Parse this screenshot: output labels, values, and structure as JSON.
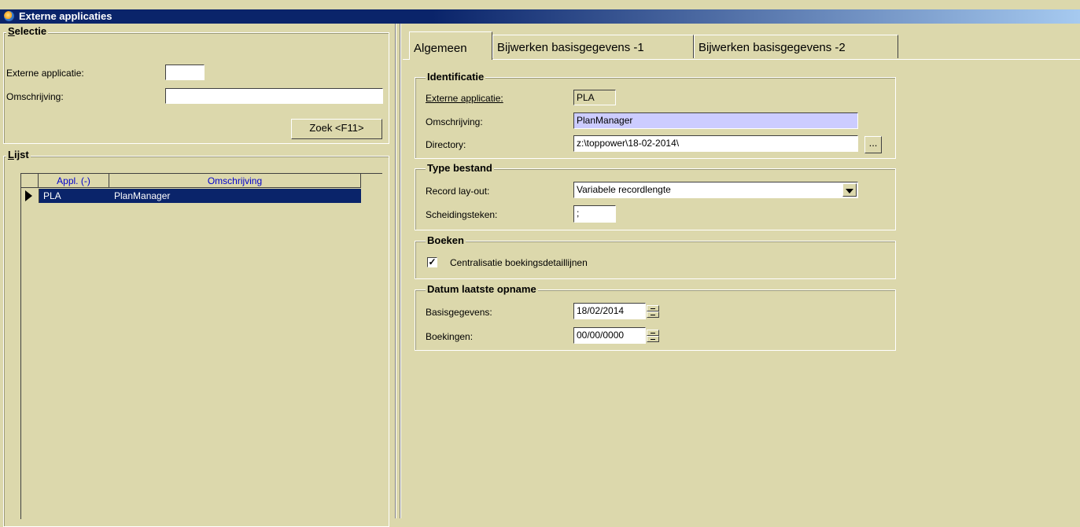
{
  "window": {
    "title": "Externe applicaties"
  },
  "selectie": {
    "title": "Selectie",
    "externe_applicatie_label": "Externe applicatie:",
    "externe_applicatie_value": "",
    "omschrijving_label": "Omschrijving:",
    "omschrijving_value": "",
    "zoek_button": "Zoek <F11>"
  },
  "lijst": {
    "title": "Lijst",
    "columns": [
      "Appl. (-)",
      "Omschrijving"
    ],
    "rows": [
      {
        "appl": "PLA",
        "omschrijving": "PlanManager"
      }
    ]
  },
  "tabs": [
    "Algemeen",
    "Bijwerken basisgegevens -1",
    "Bijwerken basisgegevens -2"
  ],
  "identificatie": {
    "title": "Identificatie",
    "externe_applicatie_label": "Externe applicatie:",
    "externe_applicatie_value": "PLA",
    "omschrijving_label": "Omschrijving:",
    "omschrijving_value": "PlanManager",
    "directory_label": "Directory:",
    "directory_value": "z:\\toppower\\18-02-2014\\",
    "browse_button": "..."
  },
  "type_bestand": {
    "title": "Type bestand",
    "record_layout_label": "Record lay-out:",
    "record_layout_value": "Variabele recordlengte",
    "scheidingsteken_label": "Scheidingsteken:",
    "scheidingsteken_value": ";"
  },
  "boeken": {
    "title": "Boeken",
    "centralisatie_label": "Centralisatie boekingsdetaillijnen",
    "centralisatie_checked": true
  },
  "datum": {
    "title": "Datum laatste opname",
    "basisgegevens_label": "Basisgegevens:",
    "basisgegevens_value": "18/02/2014",
    "boekingen_label": "Boekingen:",
    "boekingen_value": "00/00/0000"
  }
}
